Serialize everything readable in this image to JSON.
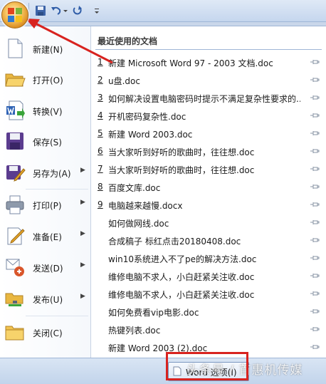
{
  "menu": {
    "commands": [
      {
        "label": "新建(N)",
        "icon": "new-document-icon",
        "has_arrow": false
      },
      {
        "label": "打开(O)",
        "icon": "open-folder-icon",
        "has_arrow": false
      },
      {
        "label": "转换(V)",
        "icon": "convert-icon",
        "has_arrow": false
      },
      {
        "label": "保存(S)",
        "icon": "save-icon",
        "has_arrow": false
      },
      {
        "label": "另存为(A)",
        "icon": "save-as-icon",
        "has_arrow": true
      },
      {
        "label": "打印(P)",
        "icon": "printer-icon",
        "has_arrow": true
      },
      {
        "label": "准备(E)",
        "icon": "prepare-icon",
        "has_arrow": true
      },
      {
        "label": "发送(D)",
        "icon": "send-icon",
        "has_arrow": true
      },
      {
        "label": "发布(U)",
        "icon": "publish-icon",
        "has_arrow": true
      },
      {
        "label": "关闭(C)",
        "icon": "close-folder-icon",
        "has_arrow": false
      }
    ]
  },
  "recent": {
    "title": "最近使用的文档",
    "documents": [
      {
        "num": "1",
        "name": "新建 Microsoft Word 97 - 2003 文档.doc"
      },
      {
        "num": "2",
        "name": "u盘.doc"
      },
      {
        "num": "3",
        "name": "如何解决设置电脑密码时提示不满足复杂性要求的..."
      },
      {
        "num": "4",
        "name": "开机密码复杂性.doc"
      },
      {
        "num": "5",
        "name": "新建 Word 2003.doc"
      },
      {
        "num": "6",
        "name": "当大家听到好听的歌曲时，往往想.doc"
      },
      {
        "num": "7",
        "name": "当大家听到好听的歌曲时，往往想.doc"
      },
      {
        "num": "8",
        "name": "百度文库.doc"
      },
      {
        "num": "9",
        "name": "电脑越来越慢.docx"
      },
      {
        "num": "",
        "name": "如何做网线.doc"
      },
      {
        "num": "",
        "name": "合成稿子 标红点击20180408.doc"
      },
      {
        "num": "",
        "name": "win10系统进入不了pe的解决方法.doc"
      },
      {
        "num": "",
        "name": "维修电脑不求人，小白赶紧关注收.doc"
      },
      {
        "num": "",
        "name": "维修电脑不求人，小白赶紧关注收.doc"
      },
      {
        "num": "",
        "name": "如何免费看vip电影.doc"
      },
      {
        "num": "",
        "name": "热键列表.doc"
      },
      {
        "num": "",
        "name": "新建 Word 2003 (2).doc"
      }
    ]
  },
  "bottom": {
    "word_options_label": "Word 选项(I)",
    "watermark": "头条号 / 首惠机传媒"
  },
  "colors": {
    "accent": "#9fb6d6",
    "annotation": "#d8231f"
  }
}
